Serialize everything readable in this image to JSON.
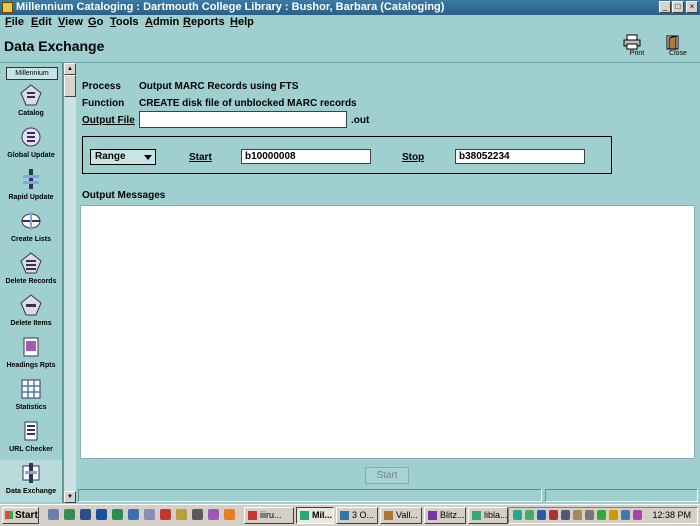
{
  "window": {
    "title": "Millennium Cataloging : Dartmouth College Library : Bushor, Barbara (Cataloging)"
  },
  "menu": [
    {
      "label": "File",
      "mnemonic": "F",
      "rest": "ile"
    },
    {
      "label": "Edit",
      "mnemonic": "E",
      "rest": "dit"
    },
    {
      "label": "View",
      "mnemonic": "V",
      "rest": "iew"
    },
    {
      "label": "Go",
      "mnemonic": "G",
      "rest": "o"
    },
    {
      "label": "Tools",
      "mnemonic": "T",
      "rest": "ools"
    },
    {
      "label": "Admin",
      "mnemonic": "A",
      "rest": "dmin"
    },
    {
      "label": "Reports",
      "mnemonic": "R",
      "rest": "eports"
    },
    {
      "label": "Help",
      "mnemonic": "H",
      "rest": "elp"
    }
  ],
  "header": {
    "title": "Data Exchange",
    "print_label": "Print",
    "close_label": "Close"
  },
  "sidebar": {
    "head": "Millennium",
    "items": [
      {
        "label": "Catalog",
        "icon": "catalog-icon",
        "active": false
      },
      {
        "label": "Global Update",
        "icon": "global-update-icon",
        "active": false
      },
      {
        "label": "Rapid Update",
        "icon": "rapid-update-icon",
        "active": false
      },
      {
        "label": "Create Lists",
        "icon": "create-lists-icon",
        "active": false
      },
      {
        "label": "Delete Records",
        "icon": "delete-records-icon",
        "active": false
      },
      {
        "label": "Delete Items",
        "icon": "delete-items-icon",
        "active": false
      },
      {
        "label": "Headings Rpts",
        "icon": "headings-reports-icon",
        "active": false
      },
      {
        "label": "Statistics",
        "icon": "statistics-icon",
        "active": false
      },
      {
        "label": "URL Checker",
        "icon": "url-checker-icon",
        "active": false
      },
      {
        "label": "Data Exchange",
        "icon": "data-exchange-icon",
        "active": true
      }
    ]
  },
  "form": {
    "process_label": "Process",
    "process_value": "Output MARC Records using FTS",
    "function_label": "Function",
    "function_value": "CREATE disk file of unblocked MARC records",
    "output_file_label": "Output File",
    "output_file_value": "",
    "output_file_suffix": ".out",
    "range_select": "Range",
    "start_label": "Start",
    "start_value": "b10000008",
    "stop_label": "Stop",
    "stop_value": "b38052234",
    "output_messages_label": "Output Messages",
    "start_button": "Start"
  },
  "taskbar": {
    "start_label": "Start",
    "buttons": [
      {
        "label": "iiiru...",
        "pressed": false
      },
      {
        "label": "Mil...",
        "pressed": true
      },
      {
        "label": "3 O...",
        "pressed": false
      },
      {
        "label": "Vall...",
        "pressed": false
      },
      {
        "label": "Blitz...",
        "pressed": false
      },
      {
        "label": "libla...",
        "pressed": false
      }
    ],
    "clock": "12:38 PM"
  }
}
